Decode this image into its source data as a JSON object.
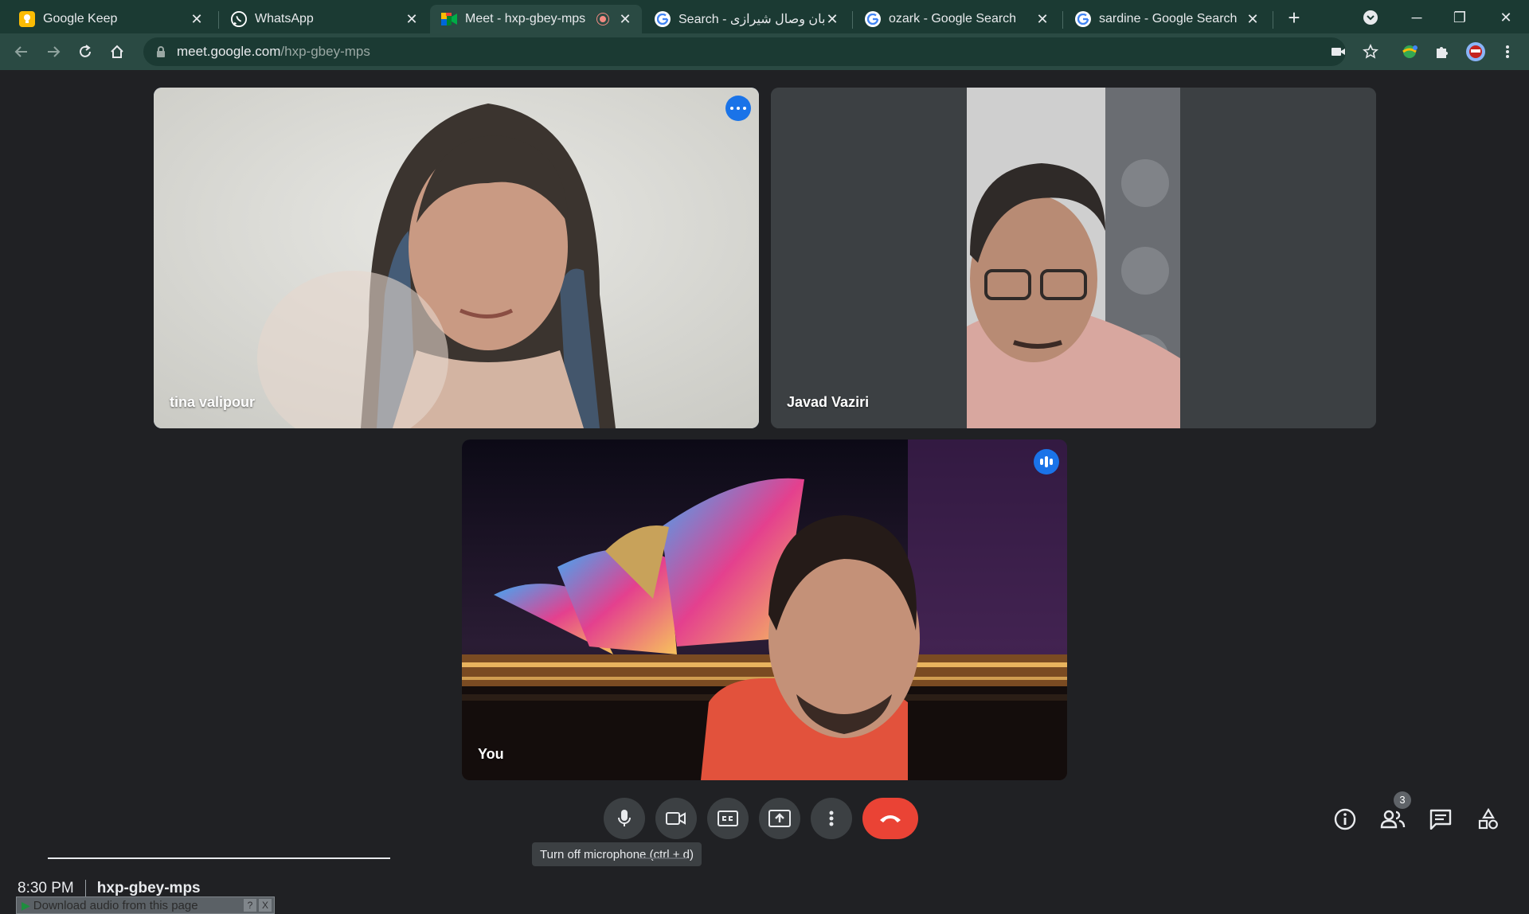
{
  "tabs": [
    {
      "label": "Google Keep",
      "icon": "keep-icon",
      "active": false
    },
    {
      "label": "WhatsApp",
      "icon": "whatsapp-icon",
      "active": false
    },
    {
      "label": "Meet - hxp-gbey-mps",
      "icon": "meet-icon",
      "active": true,
      "recording": true
    },
    {
      "label": "Search - خیابان وصال شیرازی",
      "icon": "google-icon",
      "active": false
    },
    {
      "label": "ozark - Google Search",
      "icon": "google-icon",
      "active": false
    },
    {
      "label": "sardine - Google Search",
      "icon": "google-icon",
      "active": false
    }
  ],
  "tab_close_glyph": "✕",
  "new_tab_glyph": "+",
  "window_controls": {
    "minimize": "─",
    "restore": "❐",
    "close": "✕"
  },
  "toolbar": {
    "url_host": "meet.google.com",
    "url_path": "/hxp-gbey-mps"
  },
  "participants": [
    {
      "name": "tina valipour",
      "speaking": true
    },
    {
      "name": "Javad Vaziri",
      "speaking": false
    },
    {
      "name": "You",
      "speaking": false,
      "self": true
    }
  ],
  "tooltip": "Turn off microphone (ctrl + d)",
  "meeting": {
    "time": "8:30 PM",
    "code": "hxp-gbey-mps"
  },
  "download_bar": {
    "label": "Download audio from this page",
    "help": "?",
    "close": "X"
  },
  "people_count": "3",
  "colors": {
    "tab_bg": "#1b3a33",
    "toolbar_bg": "#2a4a43",
    "stage_bg": "#202124",
    "tile_bg": "#3c4043",
    "accent_blue": "#1a73e8",
    "speaking_border": "#8ab4f8",
    "end_call_red": "#ea4335"
  }
}
